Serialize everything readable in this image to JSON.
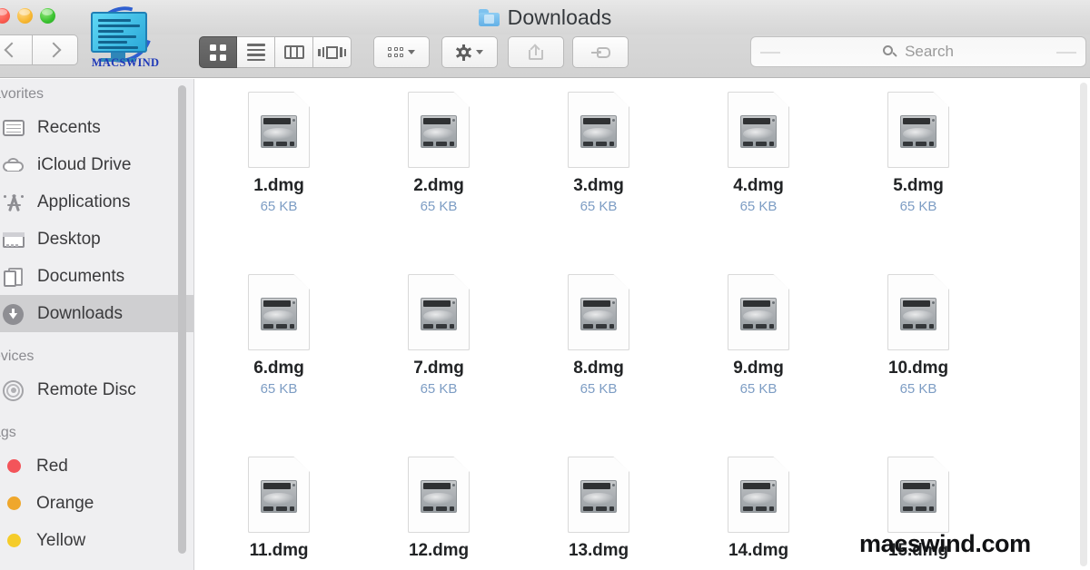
{
  "window": {
    "title": "Downloads",
    "folder_icon": "blue-folder-icon",
    "traffic_lights": [
      {
        "name": "close",
        "color": "#fb5c50"
      },
      {
        "name": "minimize",
        "color": "#f7b731"
      },
      {
        "name": "zoom",
        "color": "#39c12f"
      }
    ]
  },
  "logo": {
    "text": "MACSWIND",
    "icon": "macswind-monitor-logo"
  },
  "nav": {
    "back": "back-arrow",
    "forward": "forward-arrow"
  },
  "toolbar": {
    "view_modes": [
      {
        "name": "icon-view",
        "icon": "grid-icon",
        "active": true
      },
      {
        "name": "list-view",
        "icon": "list-icon",
        "active": false
      },
      {
        "name": "column-view",
        "icon": "columns-icon",
        "active": false
      },
      {
        "name": "coverflow-view",
        "icon": "coverflow-icon",
        "active": false
      }
    ],
    "arrange": {
      "name": "arrange-button",
      "icon": "arrange-grid-icon"
    },
    "action": {
      "name": "action-button",
      "icon": "gear-icon"
    },
    "share": {
      "name": "share-button",
      "icon": "share-icon",
      "disabled": true
    },
    "tag": {
      "name": "tag-button",
      "icon": "tag-icon"
    }
  },
  "search": {
    "placeholder": "Search",
    "value": "",
    "icon": "search-icon"
  },
  "sidebar": {
    "sections": [
      {
        "header": "avorites",
        "items": [
          {
            "label": "Recents",
            "icon": "recents-icon",
            "selected": false
          },
          {
            "label": "iCloud Drive",
            "icon": "cloud-icon",
            "selected": false
          },
          {
            "label": "Applications",
            "icon": "applications-icon",
            "selected": false
          },
          {
            "label": "Desktop",
            "icon": "desktop-icon",
            "selected": false
          },
          {
            "label": "Documents",
            "icon": "documents-icon",
            "selected": false
          },
          {
            "label": "Downloads",
            "icon": "downloads-icon",
            "selected": true
          }
        ]
      },
      {
        "header": "evices",
        "items": [
          {
            "label": "Remote Disc",
            "icon": "disc-icon",
            "selected": false
          }
        ]
      },
      {
        "header": "ags",
        "items": [
          {
            "label": "Red",
            "icon": "tag-dot",
            "color": "#f3545a",
            "selected": false
          },
          {
            "label": "Orange",
            "icon": "tag-dot",
            "color": "#efa72c",
            "selected": false
          },
          {
            "label": "Yellow",
            "icon": "tag-dot",
            "color": "#f5cc2a",
            "selected": false
          }
        ]
      }
    ]
  },
  "files": [
    {
      "name": "1.dmg",
      "size": "65 KB",
      "icon": "dmg-disk-image-icon"
    },
    {
      "name": "2.dmg",
      "size": "65 KB",
      "icon": "dmg-disk-image-icon"
    },
    {
      "name": "3.dmg",
      "size": "65 KB",
      "icon": "dmg-disk-image-icon"
    },
    {
      "name": "4.dmg",
      "size": "65 KB",
      "icon": "dmg-disk-image-icon"
    },
    {
      "name": "5.dmg",
      "size": "65 KB",
      "icon": "dmg-disk-image-icon"
    },
    {
      "name": "6.dmg",
      "size": "65 KB",
      "icon": "dmg-disk-image-icon"
    },
    {
      "name": "7.dmg",
      "size": "65 KB",
      "icon": "dmg-disk-image-icon"
    },
    {
      "name": "8.dmg",
      "size": "65 KB",
      "icon": "dmg-disk-image-icon"
    },
    {
      "name": "9.dmg",
      "size": "65 KB",
      "icon": "dmg-disk-image-icon"
    },
    {
      "name": "10.dmg",
      "size": "65 KB",
      "icon": "dmg-disk-image-icon"
    },
    {
      "name": "11.dmg",
      "size": "",
      "icon": "dmg-disk-image-icon"
    },
    {
      "name": "12.dmg",
      "size": "",
      "icon": "dmg-disk-image-icon"
    },
    {
      "name": "13.dmg",
      "size": "",
      "icon": "dmg-disk-image-icon"
    },
    {
      "name": "14.dmg",
      "size": "",
      "icon": "dmg-disk-image-icon"
    },
    {
      "name": "15.dmg",
      "size": "",
      "icon": "dmg-disk-image-icon"
    }
  ],
  "watermark": {
    "text": "macswind.com"
  }
}
